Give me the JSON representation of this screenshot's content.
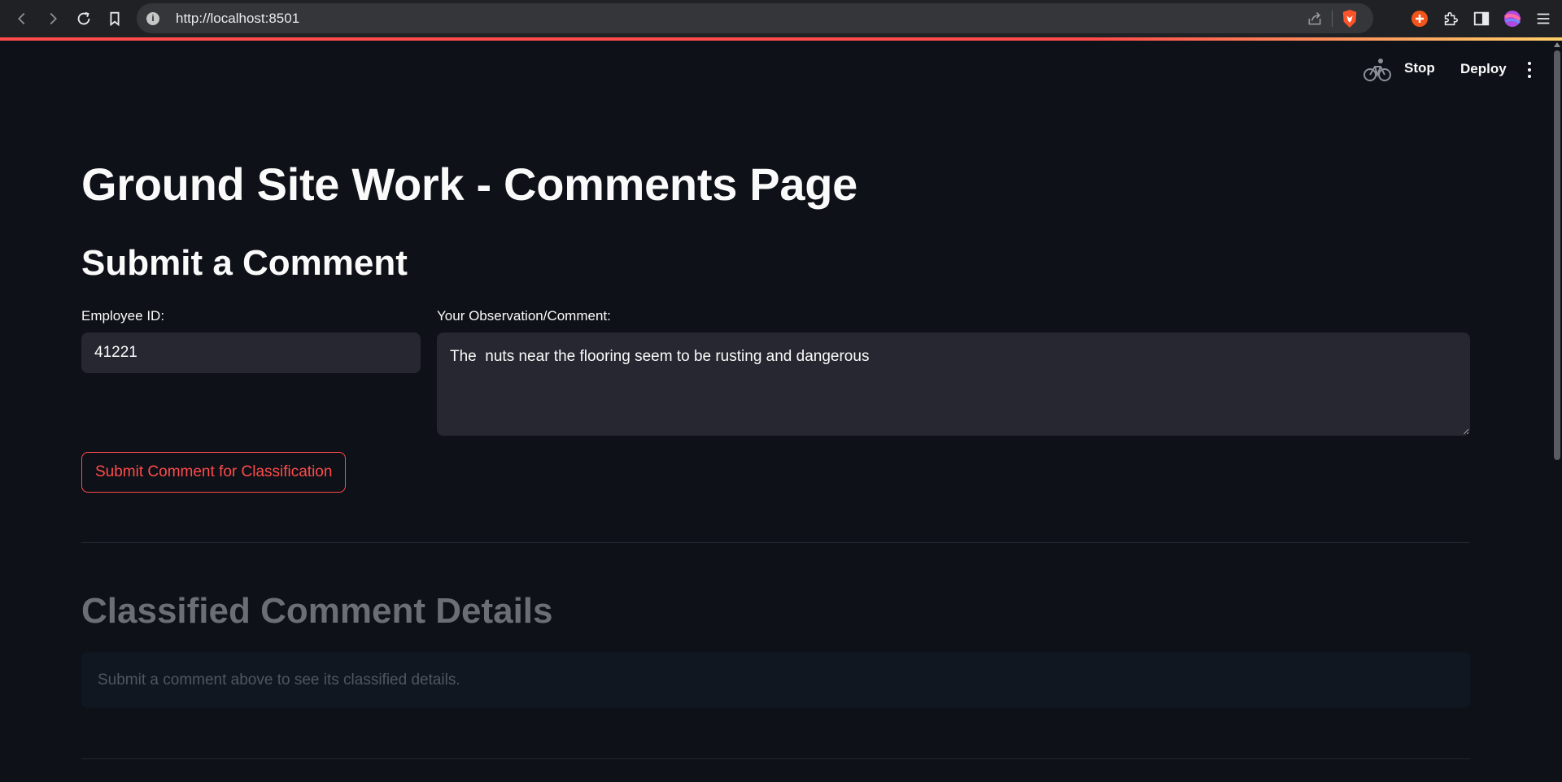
{
  "browser": {
    "url": "http://localhost:8501"
  },
  "header": {
    "stop_label": "Stop",
    "deploy_label": "Deploy"
  },
  "page": {
    "title": "Ground Site Work - Comments Page",
    "section_title": "Submit a Comment",
    "employee_id": {
      "label": "Employee ID:",
      "value": "41221"
    },
    "comment": {
      "label": "Your Observation/Comment:",
      "value": "The  nuts near the flooring seem to be rusting and dangerous"
    },
    "submit_label": "Submit Comment for Classification",
    "classified_title": "Classified Comment Details",
    "info_message": "Submit a comment above to see its classified details."
  },
  "colors": {
    "background": "#0e1117",
    "input_bg": "#262730",
    "accent": "#ff4b4b",
    "muted_title": "#6b6e75"
  }
}
